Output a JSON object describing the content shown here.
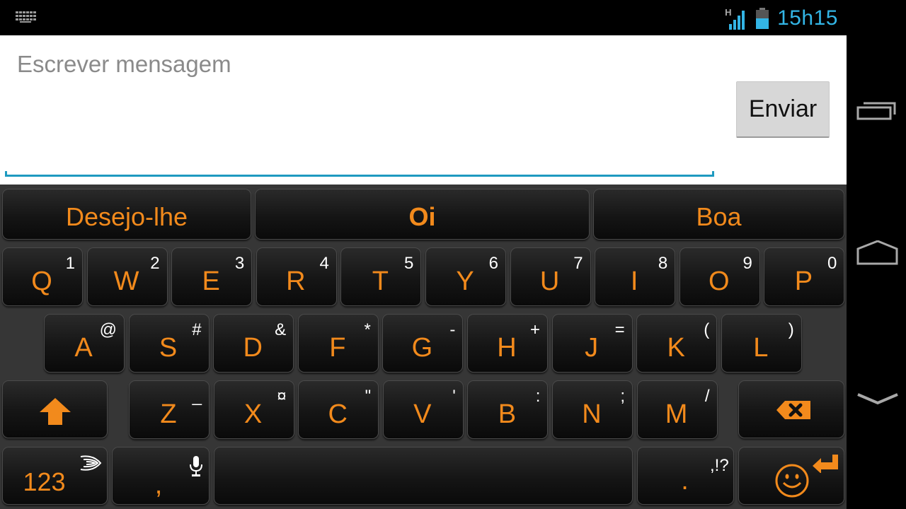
{
  "status_bar": {
    "keyboard_icon": "keyboard-icon",
    "network_type": "H",
    "signal_bars": 4,
    "battery_level": 0.55,
    "clock": "15h15",
    "accent_color": "#33b5e5"
  },
  "compose": {
    "placeholder": "Escrever mensagem",
    "value": "",
    "send_label": "Enviar",
    "underline_color": "#1e9ac0"
  },
  "keyboard": {
    "key_label_color": "#f28a1c",
    "suggestions": [
      {
        "label": "Desejo-lhe",
        "bold": false
      },
      {
        "label": "Oi",
        "bold": true
      },
      {
        "label": "Boa",
        "bold": false
      }
    ],
    "row1": [
      {
        "label": "Q",
        "sub": "1"
      },
      {
        "label": "W",
        "sub": "2"
      },
      {
        "label": "E",
        "sub": "3"
      },
      {
        "label": "R",
        "sub": "4"
      },
      {
        "label": "T",
        "sub": "5"
      },
      {
        "label": "Y",
        "sub": "6"
      },
      {
        "label": "U",
        "sub": "7"
      },
      {
        "label": "I",
        "sub": "8"
      },
      {
        "label": "O",
        "sub": "9"
      },
      {
        "label": "P",
        "sub": "0"
      }
    ],
    "row2": [
      {
        "label": "A",
        "sub": "@"
      },
      {
        "label": "S",
        "sub": "#"
      },
      {
        "label": "D",
        "sub": "&"
      },
      {
        "label": "F",
        "sub": "*"
      },
      {
        "label": "G",
        "sub": "-"
      },
      {
        "label": "H",
        "sub": "+"
      },
      {
        "label": "J",
        "sub": "="
      },
      {
        "label": "K",
        "sub": "("
      },
      {
        "label": "L",
        "sub": ")"
      }
    ],
    "row3": [
      {
        "label": "Z",
        "sub": "_"
      },
      {
        "label": "X",
        "sub": "¤"
      },
      {
        "label": "C",
        "sub": "\""
      },
      {
        "label": "V",
        "sub": "'"
      },
      {
        "label": "B",
        "sub": ":"
      },
      {
        "label": "N",
        "sub": ";"
      },
      {
        "label": "M",
        "sub": "/"
      }
    ],
    "shift_icon": "shift-arrow-icon",
    "backspace_icon": "backspace-icon",
    "numbers_label": "123",
    "swiftkey_icon": "swiftkey-logo-icon",
    "comma_label": ",",
    "mic_icon": "microphone-icon",
    "space_label": "",
    "period_label": ".",
    "period_sub": ",!?",
    "emoji_icon": "smiley-icon",
    "enter_icon": "enter-arrow-icon"
  },
  "nav_bar": {
    "recents": "recent-apps-icon",
    "home": "home-icon",
    "back": "hide-keyboard-icon"
  }
}
